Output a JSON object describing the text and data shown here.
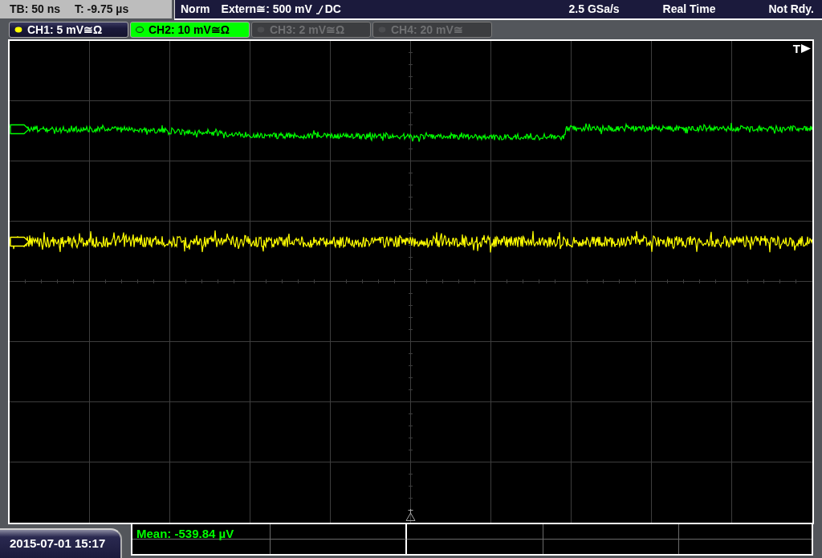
{
  "top_bar": {
    "timebase": "TB: 50 ns",
    "trigger_offset": "T: -9.75 µs",
    "trigger_mode": "Norm",
    "trigger_source": "Extern≅: 500 mV",
    "trigger_coupling": "DC",
    "sample_rate": "2.5 GSa/s",
    "acquisition_mode": "Real Time",
    "status": "Not Rdy."
  },
  "channels": [
    {
      "label": "CH1: 5 mV≅Ω",
      "color": "#ffff00",
      "on": true,
      "selected": false
    },
    {
      "label": "CH2: 10 mV≅Ω",
      "color": "#00ff00",
      "on": true,
      "selected": true
    },
    {
      "label": "CH3: 2 mV≅Ω",
      "on": false,
      "selected": false
    },
    {
      "label": "CH4: 20 mV≅",
      "on": false,
      "selected": false
    }
  ],
  "plot": {
    "trigger_marker": "T"
  },
  "measurements": [
    {
      "text": "Mean: -539.84 µV"
    }
  ],
  "date_time": "2015-07-01 15:17"
}
